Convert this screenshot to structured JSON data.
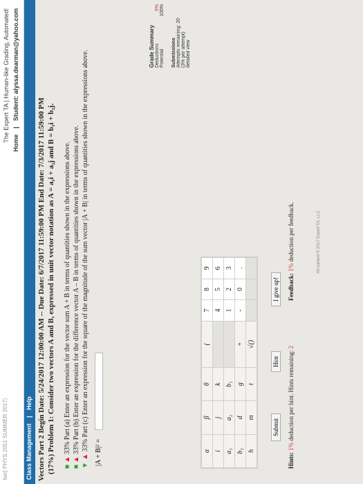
{
  "header": {
    "left_text": "ber] PHYS 2051 SUMMER 2017)",
    "brand": "The Expert TA | Human-like Grading, Automated!",
    "nav_home": "Home",
    "nav_sep": "|",
    "student": "Student: alyssa.dearman@yahoo.com"
  },
  "menu": {
    "class_management": "Class Management",
    "sep": "|",
    "help": "Help"
  },
  "assignment": {
    "title": "Vectors Part 2 Begin Date: 5/24/2017 12:00:00 AM -- Due Date: 6/7/2017 11:59:00 PM End Date: 7/3/2017 11:59:00 PM",
    "problem": "(17%) Problem 1: Consider two vectors A and B, expressed in unit vector notation as A = a₁i + a₂j and B = b₁i + b₂j."
  },
  "parts": [
    {
      "text": "33% Part (a) Enter an expression for the vector sum A + B in terms of quantities shown in the expressions above."
    },
    {
      "text": "33% Part (b) Enter an expression for the difference vector A – B in terms of quantities shown in the expressions above."
    },
    {
      "text": "33% Part (c) Enter an expression for the square of the magnitude of the sum vector |A + B| in terms of quantities shown in the expressions above."
    }
  ],
  "answer": {
    "label": "|A + B|² =",
    "value": ""
  },
  "grade_summary": {
    "title": "Grade Summary",
    "deductions_label": "Deductions",
    "deductions_value": "0%",
    "potential_label": "Potential",
    "potential_value": "100%",
    "submissions_label": "Submissions",
    "attempts": "Attempts remaining: 20",
    "per_attempt": "(3% per attempt)",
    "detailed": "detailed view"
  },
  "keypad": {
    "rows": [
      [
        "α",
        "β",
        "θ",
        "(",
        "7",
        "8",
        "9"
      ],
      [
        "i",
        "j",
        "k",
        "",
        "4",
        "5",
        "6"
      ],
      [
        "a₁",
        "a₂",
        "b₁",
        "",
        "1",
        "2",
        "3"
      ],
      [
        "b₂",
        "d",
        "g",
        "+",
        "-",
        "0",
        "."
      ],
      [
        "h",
        "m",
        "t",
        "√()",
        "",
        "",
        ""
      ]
    ]
  },
  "buttons": {
    "submit": "Submit",
    "hint": "Hint",
    "give_up": "I give up!"
  },
  "hints": {
    "label": "Hints:",
    "pct": "1%",
    "text": "deduction per hint. Hints remaining:",
    "remaining": "2"
  },
  "feedback": {
    "label": "Feedback:",
    "pct": "1%",
    "text": "deduction per feedback."
  },
  "footer": "All content © 2017 Expert TA, LLC"
}
